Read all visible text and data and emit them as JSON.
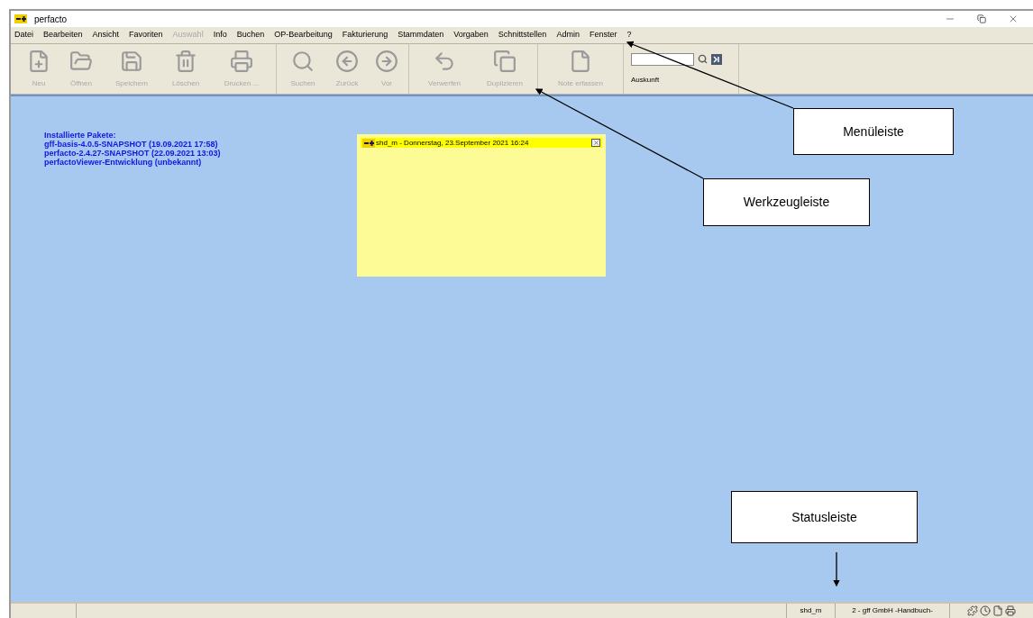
{
  "window": {
    "title": "perfacto"
  },
  "menu": [
    {
      "label": "Datei",
      "disabled": false
    },
    {
      "label": "Bearbeiten",
      "disabled": false
    },
    {
      "label": "Ansicht",
      "disabled": false
    },
    {
      "label": "Favoriten",
      "disabled": false
    },
    {
      "label": "Auswahl",
      "disabled": true
    },
    {
      "label": "Info",
      "disabled": false
    },
    {
      "label": "Buchen",
      "disabled": false
    },
    {
      "label": "OP-Bearbeitung",
      "disabled": false
    },
    {
      "label": "Fakturierung",
      "disabled": false
    },
    {
      "label": "Stammdaten",
      "disabled": false
    },
    {
      "label": "Vorgaben",
      "disabled": false
    },
    {
      "label": "Schnittstellen",
      "disabled": false
    },
    {
      "label": "Admin",
      "disabled": false
    },
    {
      "label": "Fenster",
      "disabled": false
    },
    {
      "label": "?",
      "disabled": false
    }
  ],
  "toolbar": [
    [
      {
        "label": "Neu",
        "disabled": true
      },
      {
        "label": "Öffnen",
        "disabled": true
      },
      {
        "label": "Speichern",
        "disabled": true
      },
      {
        "label": "Löschen",
        "disabled": true
      },
      {
        "label": "Drucken ...",
        "disabled": true
      }
    ],
    [
      {
        "label": "Suchen",
        "disabled": true
      },
      {
        "label": "Zurück",
        "disabled": true
      },
      {
        "label": "Vor",
        "disabled": true
      }
    ],
    [
      {
        "label": "Verwerfen",
        "disabled": true
      },
      {
        "label": "Duplizieren",
        "disabled": true
      }
    ],
    [
      {
        "label": "Note erfassen",
        "disabled": true
      }
    ]
  ],
  "auskunft": {
    "label": "Auskunft"
  },
  "packages": {
    "title": "Installierte Pakete:",
    "items": [
      "gff-basis-4.0.5-SNAPSHOT (19.09.2021 17:58)",
      "perfacto-2.4.27-SNAPSHOT (22.09.2021 13:03)",
      "perfactoViewer-Entwicklung (unbekannt)"
    ]
  },
  "note": {
    "title": "shd_m - Donnerstag, 23.September 2021 16:24"
  },
  "status_bar": {
    "segments": [
      "shd_m",
      "2 - gff GmbH -Handbuch-"
    ]
  },
  "callouts": [
    {
      "label": "Menüleiste"
    },
    {
      "label": "Werkzeugleiste"
    },
    {
      "label": "Statusleiste"
    }
  ]
}
